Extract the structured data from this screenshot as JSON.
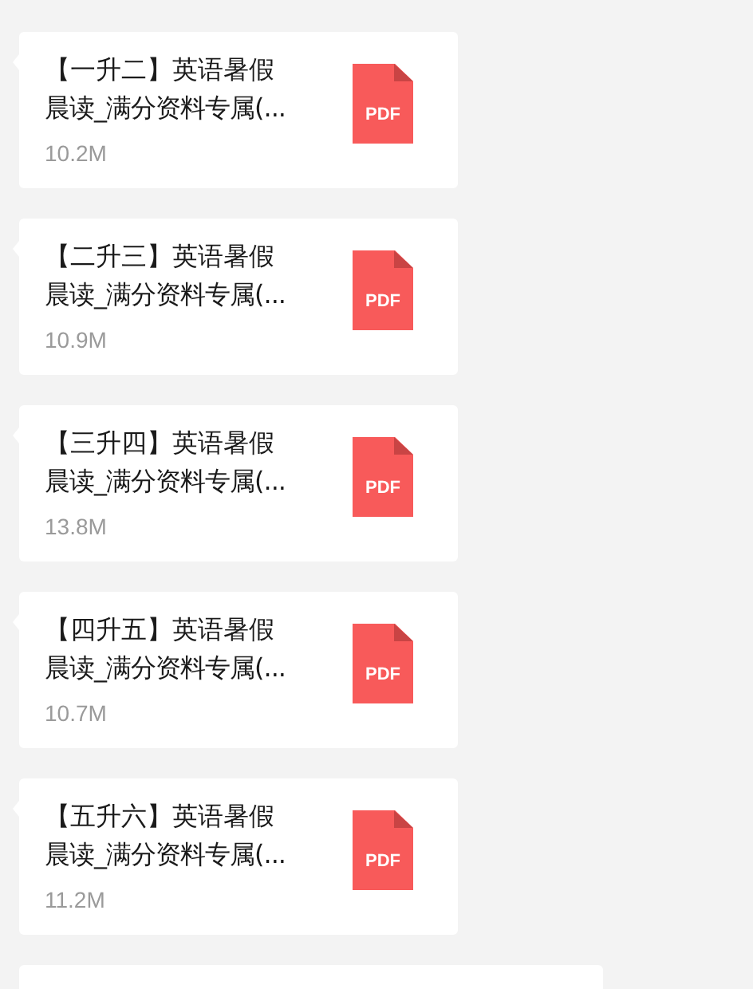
{
  "messages": [
    {
      "kind": "file",
      "title_line1": "【一升二】英语暑假",
      "title_line2": "晨读_满分资料专属(...",
      "size": "10.2M",
      "file_type": "PDF"
    },
    {
      "kind": "file",
      "title_line1": "【二升三】英语暑假",
      "title_line2": "晨读_满分资料专属(...",
      "size": "10.9M",
      "file_type": "PDF"
    },
    {
      "kind": "file",
      "title_line1": "【三升四】英语暑假",
      "title_line2": "晨读_满分资料专属(...",
      "size": "13.8M",
      "file_type": "PDF"
    },
    {
      "kind": "file",
      "title_line1": "【四升五】英语暑假",
      "title_line2": "晨读_满分资料专属(...",
      "size": "10.7M",
      "file_type": "PDF"
    },
    {
      "kind": "file",
      "title_line1": "【五升六】英语暑假",
      "title_line2": "晨读_满分资料专属(...",
      "size": "11.2M",
      "file_type": "PDF"
    },
    {
      "kind": "partial"
    }
  ]
}
